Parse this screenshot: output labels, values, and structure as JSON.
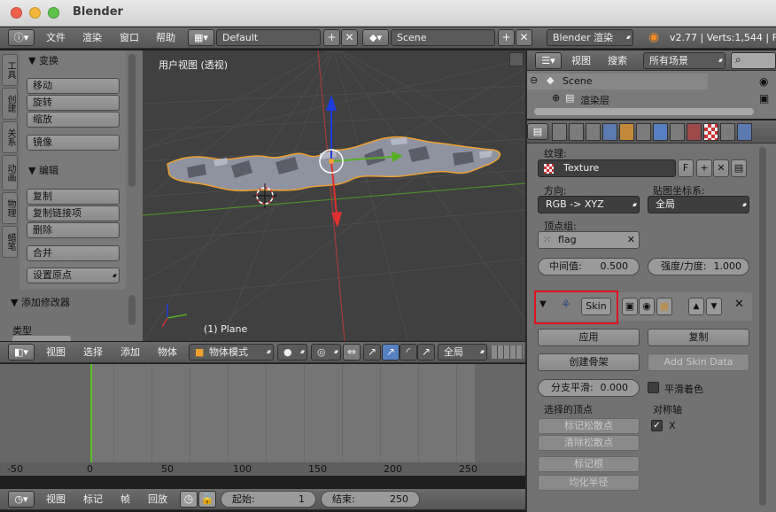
{
  "window": {
    "title": "Blender"
  },
  "top_header": {
    "menus": [
      "文件",
      "渲染",
      "窗口",
      "帮助"
    ],
    "screen_layout": "Default",
    "scene": "Scene",
    "render_engine": "Blender 渲染",
    "stats": "v2.77 | Verts:1,544 | F"
  },
  "tool_shelf": {
    "tabs": [
      "工具",
      "创建",
      "关系",
      "动画",
      "物理",
      "蜡笔"
    ],
    "transform_title": "▼ 变换",
    "transform_buttons": [
      "移动",
      "旋转",
      "缩放"
    ],
    "mirror_button": "镜像",
    "edit_title": "▼ 编辑",
    "edit_buttons": [
      "复制",
      "复制链接项",
      "删除"
    ],
    "join_button": "合并",
    "set_origin": "设置原点",
    "add_modifier_title": "▼ 添加修改器",
    "type_label": "类型"
  },
  "viewport": {
    "view_label": "用户视图 (透视)",
    "object_label": "(1) Plane"
  },
  "viewport_header": {
    "menus": [
      "视图",
      "选择",
      "添加",
      "物体"
    ],
    "mode": "物体模式",
    "transform_orientation": "全局"
  },
  "timeline": {
    "ruler": [
      "-50",
      "0",
      "50",
      "100",
      "150",
      "200",
      "250"
    ],
    "menus": [
      "视图",
      "标记",
      "帧",
      "回放"
    ],
    "start_label": "起始:",
    "start_value": "1",
    "end_label": "结束:",
    "end_value": "250"
  },
  "outliner_header": {
    "menus": [
      "视图",
      "搜索"
    ],
    "filter": "所有场景"
  },
  "outliner": {
    "items": [
      "Scene",
      "渲染层"
    ]
  },
  "properties": {
    "texture_label": "纹理:",
    "texture_name": "Texture",
    "texture_fake_user": "F",
    "direction_label": "方向:",
    "direction_value": "RGB -> XYZ",
    "texcoords_label": "贴图坐标系:",
    "texcoords_value": "全局",
    "vgroup_label": "顶点组:",
    "vgroup_value": "flag",
    "midlevel_label": "中间值:",
    "midlevel_value": "0.500",
    "strength_label": "强度/力度:",
    "strength_value": "1.000",
    "modifier_name": "Skin",
    "apply_button": "应用",
    "copy_button": "复制",
    "create_armature_button": "创建骨架",
    "add_skin_data_button": "Add Skin Data",
    "branch_smooth_label": "分支平滑:",
    "branch_smooth_value": "0.000",
    "smooth_shading_label": "平滑着色",
    "selected_verts_label": "选择的顶点",
    "symmetry_label": "对称轴",
    "mark_loose_button": "标记松散点",
    "clear_loose_button": "清除松散点",
    "mark_root_button": "标记根",
    "equalize_radii_button": "均化半径",
    "axis_x": "X"
  },
  "colors": {
    "highlight_box": "#e0141e",
    "x_axis": "#c83232",
    "y_axis": "#55b024",
    "z_axis": "#1e3cdc",
    "selection_outline": "#f0a030",
    "current_frame": "#58c224"
  }
}
